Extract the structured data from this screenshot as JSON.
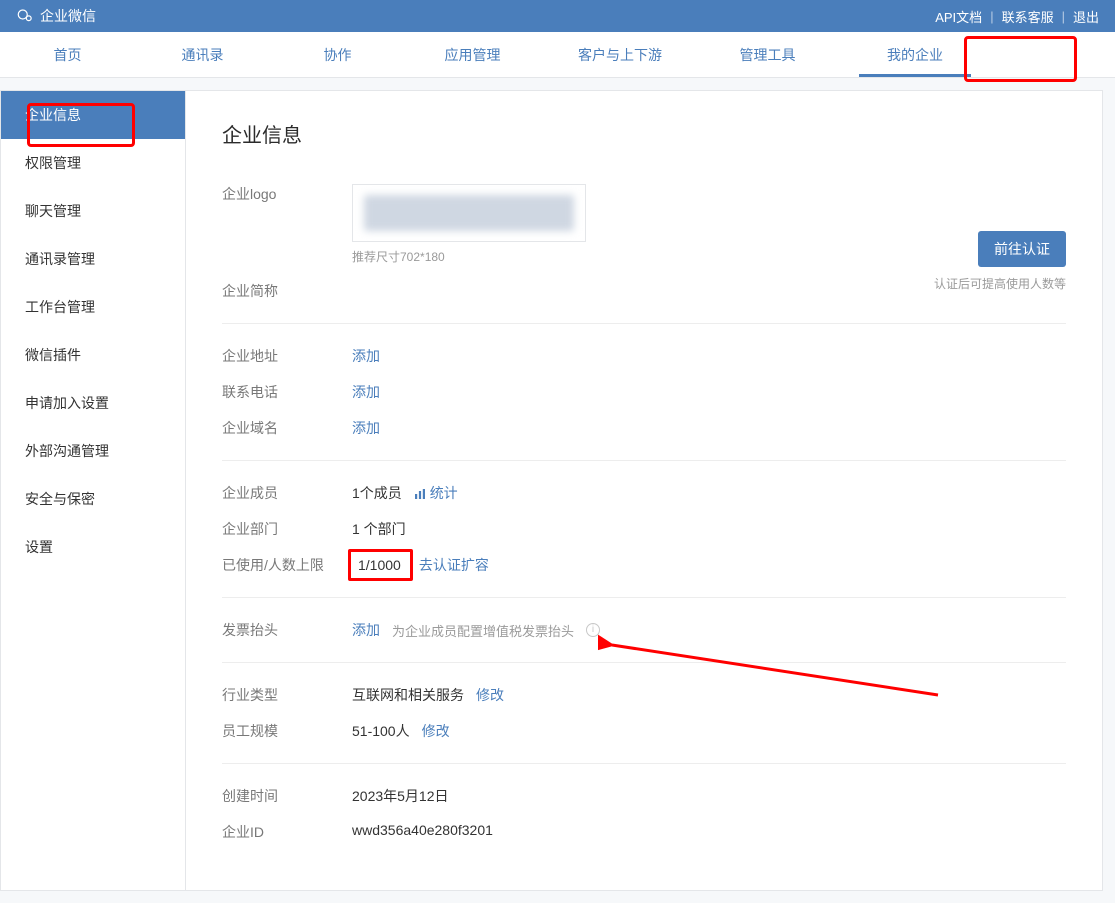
{
  "header": {
    "brand": "企业微信",
    "links": {
      "api": "API文档",
      "contact": "联系客服",
      "logout": "退出"
    }
  },
  "nav": {
    "items": [
      "首页",
      "通讯录",
      "协作",
      "应用管理",
      "客户与上下游",
      "管理工具",
      "我的企业"
    ],
    "activeIndex": 6
  },
  "sidebar": {
    "items": [
      "企业信息",
      "权限管理",
      "聊天管理",
      "通讯录管理",
      "工作台管理",
      "微信插件",
      "申请加入设置",
      "外部沟通管理",
      "安全与保密",
      "设置"
    ],
    "activeIndex": 0
  },
  "page": {
    "title": "企业信息",
    "logo": {
      "label": "企业logo",
      "hint": "推荐尺寸702*180"
    },
    "shortname_label": "企业简称",
    "cert_button": "前往认证",
    "cert_hint": "认证后可提高使用人数等",
    "address": {
      "label": "企业地址",
      "action": "添加"
    },
    "phone": {
      "label": "联系电话",
      "action": "添加"
    },
    "domain": {
      "label": "企业域名",
      "action": "添加"
    },
    "members": {
      "label": "企业成员",
      "value": "1个成员",
      "stats": "统计"
    },
    "depts": {
      "label": "企业部门",
      "value": "1 个部门"
    },
    "limit": {
      "label": "已使用/人数上限",
      "value": "1/1000",
      "action": "去认证扩容"
    },
    "invoice": {
      "label": "发票抬头",
      "action": "添加",
      "hint": "为企业成员配置增值税发票抬头"
    },
    "industry": {
      "label": "行业类型",
      "value": "互联网和相关服务",
      "action": "修改"
    },
    "scale": {
      "label": "员工规模",
      "value": "51-100人",
      "action": "修改"
    },
    "created": {
      "label": "创建时间",
      "value": "2023年5月12日"
    },
    "corpid": {
      "label": "企业ID",
      "value": "wwd356a40e280f3201"
    }
  }
}
